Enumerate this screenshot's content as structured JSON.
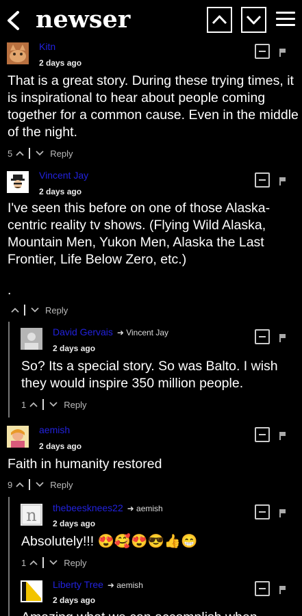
{
  "app": {
    "logo": "newser"
  },
  "comments": [
    {
      "author": "Kitn",
      "reply_to": "",
      "time": "2 days ago",
      "body": "That is a great story. During these trying times, it is inspirational to hear about people coming together for a common cause. Even in the middle of the night.",
      "votes": "5",
      "reply_label": "Reply"
    },
    {
      "author": "Vincent Jay",
      "reply_to": "",
      "time": "2 days ago",
      "body": "I've seen this before on one of those Alaska-centric reality tv shows. (Flying Wild Alaska, Mountain Men, Yukon Men, Alaska the Last Frontier, Life Below Zero, etc.)",
      "body_extra": ".",
      "votes": "",
      "reply_label": "Reply"
    },
    {
      "author": "David Gervais",
      "reply_to": "Vincent Jay",
      "time": "2 days ago",
      "body": "So? Its a special story. So was Balto. I wish they would inspire 350 million people.",
      "votes": "1",
      "reply_label": "Reply"
    },
    {
      "author": "aemish",
      "reply_to": "",
      "time": "2 days ago",
      "body": "Faith in humanity restored",
      "votes": "9",
      "reply_label": "Reply"
    },
    {
      "author": "thebeesknees22",
      "reply_to": "aemish",
      "time": "2 days ago",
      "body": "Absolutely!!! 😍🥰😍😎👍😁",
      "votes": "1",
      "reply_label": "Reply"
    },
    {
      "author": "Liberty Tree",
      "reply_to": "aemish",
      "time": "2 days ago",
      "body": "Amazing what we can accomplish when",
      "votes": "",
      "reply_label": "Reply"
    }
  ]
}
